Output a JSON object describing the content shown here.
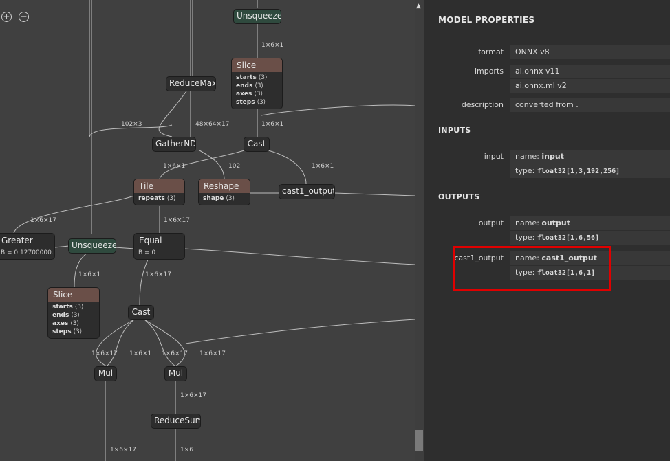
{
  "graph": {
    "nodes": {
      "unsqueeze_top": "Unsqueeze",
      "slice_top": {
        "title": "Slice",
        "attrs": [
          {
            "k": "starts",
            "v": "⟨3⟩"
          },
          {
            "k": "ends",
            "v": "⟨3⟩"
          },
          {
            "k": "axes",
            "v": "⟨3⟩"
          },
          {
            "k": "steps",
            "v": "⟨3⟩"
          }
        ]
      },
      "reducemax": "ReduceMax",
      "gathernd": "GatherND",
      "cast_top": "Cast",
      "tile": {
        "title": "Tile",
        "attrs": [
          {
            "k": "repeats",
            "v": "⟨3⟩"
          }
        ]
      },
      "reshape": {
        "title": "Reshape",
        "attrs": [
          {
            "k": "shape",
            "v": "⟨3⟩"
          }
        ]
      },
      "cast1_output": "cast1_output",
      "greater": {
        "title": "Greater",
        "attr": "B = 0.12700000..."
      },
      "unsqueeze_mid": "Unsqueeze",
      "equal": {
        "title": "Equal",
        "attr": "B = 0"
      },
      "slice_bottom": {
        "title": "Slice",
        "attrs": [
          {
            "k": "starts",
            "v": "⟨3⟩"
          },
          {
            "k": "ends",
            "v": "⟨3⟩"
          },
          {
            "k": "axes",
            "v": "⟨3⟩"
          },
          {
            "k": "steps",
            "v": "⟨3⟩"
          }
        ]
      },
      "cast_bottom": "Cast",
      "mul_left": "Mul",
      "mul_right": "Mul",
      "reducesum": "ReduceSum"
    },
    "edge_labels": {
      "e1": "1×6×1",
      "e2": "102×3",
      "e3": "48×64×17",
      "e4": "1×6×1",
      "e5": "1×6×1",
      "e6": "102",
      "e7": "1×6×1",
      "e8": "1×6×17",
      "e9": "1×6×17",
      "e10": "1×6×1",
      "e11": "1×6×17",
      "e12": "1×6×17",
      "e13": "1×6×1",
      "e14": "1×6×17",
      "e15": "1×6×17",
      "e16": "1×6×17",
      "e17": "1×6×17",
      "e18": "1×6"
    },
    "zoom_in": "+",
    "zoom_out": "−",
    "scroll_up": "▲"
  },
  "panel": {
    "title": "MODEL PROPERTIES",
    "format_label": "format",
    "format_value": "ONNX v8",
    "imports_label": "imports",
    "imports_values": [
      "ai.onnx v11",
      "ai.onnx.ml v2"
    ],
    "description_label": "description",
    "description_value": "converted from .",
    "inputs_title": "INPUTS",
    "input": {
      "label": "input",
      "name_key": "name:",
      "name": "input",
      "type_key": "type:",
      "type": "float32[1,3,192,256]"
    },
    "outputs_title": "OUTPUTS",
    "output": {
      "label": "output",
      "name_key": "name:",
      "name": "output",
      "type_key": "type:",
      "type": "float32[1,6,56]"
    },
    "cast1": {
      "label": "cast1_output",
      "name_key": "name:",
      "name": "cast1_output",
      "type_key": "type:",
      "type": "float32[1,6,1]"
    }
  },
  "colors": {
    "highlight": "#e00000",
    "op_header": "#6a4f48",
    "unsqueeze": "#2f4a3e"
  }
}
